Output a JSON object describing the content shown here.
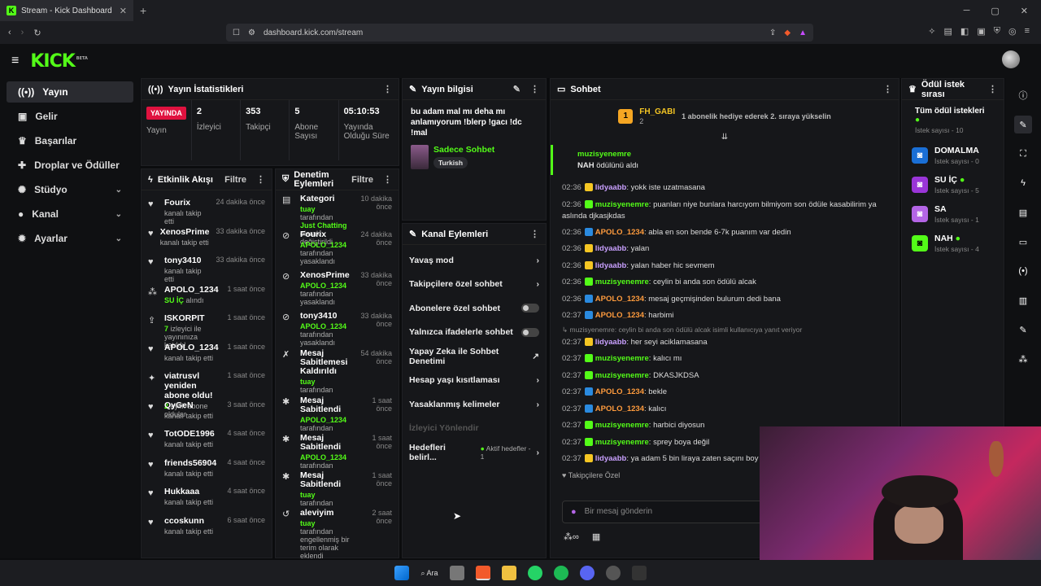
{
  "browser": {
    "tab_title": "Stream - Kick Dashboard",
    "url": "dashboard.kick.com/stream"
  },
  "brand": {
    "logo": "KICK",
    "beta": "BETA",
    "accent": "#53fc18"
  },
  "sidebar": {
    "items": [
      {
        "label": "Yayın",
        "icon": "broadcast-icon"
      },
      {
        "label": "Gelir",
        "icon": "wallet-icon"
      },
      {
        "label": "Başarılar",
        "icon": "trophy-icon"
      },
      {
        "label": "Droplar ve Ödüller",
        "icon": "gift-icon"
      },
      {
        "label": "Stüdyo",
        "icon": "gear-icon"
      },
      {
        "label": "Kanal",
        "icon": "person-icon"
      },
      {
        "label": "Ayarlar",
        "icon": "settings-icon"
      }
    ]
  },
  "stats": {
    "title": "Yayın İstatistikleri",
    "live_badge": "YAYINDA",
    "live_label": "Yayın",
    "viewers": "2",
    "viewers_label": "İzleyici",
    "followers": "353",
    "followers_label": "Takipçi",
    "subs": "5",
    "subs_label": "Abone Sayısı",
    "duration": "05:10:53",
    "duration_label": "Yayında Olduğu Süre"
  },
  "stream_info": {
    "title": "Yayın bilgisi",
    "stream_title": "bu adam mal mı deha mı anlamıyorum !blerp !gacı !dc !mal",
    "category": "Sadece Sohbet",
    "language": "Turkish"
  },
  "activity": {
    "title": "Etkinlik Akışı",
    "filter": "Filtre",
    "items": [
      {
        "name": "Fourix",
        "sub": "kanalı takip etti",
        "time": "24 dakika önce"
      },
      {
        "name": "XenosPrime",
        "sub": "kanalı takip etti",
        "time": "33 dakika önce"
      },
      {
        "name": "tony3410",
        "sub": "kanalı takip etti",
        "time": "33 dakika önce"
      },
      {
        "name": "APOLO_1234",
        "sub_hl": "SU İÇ",
        "sub": "alındı",
        "time": "1 saat önce"
      },
      {
        "name": "ISKORPIT",
        "sub_hl": "7",
        "sub": "izleyici ile yayınınıza katıldı!",
        "time": "1 saat önce"
      },
      {
        "name": "APOLO_1234",
        "sub": "kanalı takip etti",
        "time": "1 saat önce"
      },
      {
        "name": "viatrusvl yeniden abone oldu!",
        "sub_hl": "2",
        "sub": "aylık abone oldular",
        "time": "1 saat önce"
      },
      {
        "name": "QyGeN",
        "sub": "kanalı takip etti",
        "time": "3 saat önce"
      },
      {
        "name": "TotODE1996",
        "sub": "kanalı takip etti",
        "time": "4 saat önce"
      },
      {
        "name": "friends56904",
        "sub": "kanalı takip etti",
        "time": "4 saat önce"
      },
      {
        "name": "Hukkaaa",
        "sub": "kanalı takip etti",
        "time": "4 saat önce"
      },
      {
        "name": "ccoskunn",
        "sub": "kanalı takip etti",
        "time": "6 saat önce"
      }
    ]
  },
  "moderation": {
    "title": "Denetim Eylemleri",
    "filter": "Filtre",
    "items": [
      {
        "name": "Kategori",
        "hl": "tuay",
        "sub": "tarafından",
        "hl2": "Just Chatting",
        "sub2": "olarak değiştirildi",
        "time": "10 dakika önce"
      },
      {
        "name": "Fourix",
        "hl": "APOLO_1234",
        "sub": "tarafından yasaklandı",
        "time": "24 dakika önce"
      },
      {
        "name": "XenosPrime",
        "hl": "APOLO_1234",
        "sub": "tarafından yasaklandı",
        "time": "33 dakika önce"
      },
      {
        "name": "tony3410",
        "hl": "APOLO_1234",
        "sub": "tarafından yasaklandı",
        "time": "33 dakika önce"
      },
      {
        "name": "Mesaj Sabitlemesi Kaldırıldı",
        "hl": "tuay",
        "sub": "tarafından",
        "time": "54 dakika önce"
      },
      {
        "name": "Mesaj Sabitlendi",
        "hl": "APOLO_1234",
        "sub": "tarafından",
        "time": "1 saat önce"
      },
      {
        "name": "Mesaj Sabitlendi",
        "hl": "APOLO_1234",
        "sub": "tarafından",
        "time": "1 saat önce"
      },
      {
        "name": "Mesaj Sabitlendi",
        "hl": "tuay",
        "sub": "tarafından",
        "time": "1 saat önce"
      },
      {
        "name": "aleviyim",
        "hl": "tuay",
        "sub": "tarafından engellenmiş bir terim olarak eklendi",
        "time": "2 saat önce"
      }
    ]
  },
  "channel_actions": {
    "title": "Kanal Eylemleri",
    "items": [
      {
        "label": "Yavaş mod"
      },
      {
        "label": "Takipçilere özel sohbet"
      },
      {
        "label": "Abonelere özel sohbet"
      },
      {
        "label": "Yalnızca ifadelerle sohbet"
      },
      {
        "label": "Yapay Zeka ile Sohbet Denetimi"
      },
      {
        "label": "Hesap yaşı kısıtlaması"
      },
      {
        "label": "Yasaklanmış kelimeler"
      },
      {
        "label": "İzleyici Yönlendir"
      },
      {
        "label": "Hedefleri belirl...",
        "extra": "Aktif hedefler - 1"
      }
    ]
  },
  "chat": {
    "title": "Sohbet",
    "gift_user": "FH_GABI",
    "gift_count": "2",
    "gift_text": "1 abonelik hediye ederek 2. sıraya yükselin",
    "pinned_user": "muzisyenemre",
    "pinned_hl": "NAH",
    "pinned_text": "ödülünü aldı",
    "reply_note": "muzisyenemre: ceylin bi anda son ödülü alcak isimli kullanıcıya yanıt veriyor",
    "messages": [
      {
        "t": "02:36",
        "n": "lidyaabb",
        "c": "#c9a0ff",
        "m": "yokk iste uzatmasana"
      },
      {
        "t": "02:36",
        "n": "muzisyenemre",
        "c": "#53fc18",
        "m": "puanları niye bunlara harcıyom bilmiyom son ödüle kasabilirim ya aslında djkasjkdas"
      },
      {
        "t": "02:36",
        "n": "APOLO_1234",
        "c": "#ff9b3d",
        "m": "abla en son bende 6-7k puanım var dedin"
      },
      {
        "t": "02:36",
        "n": "lidyaabb",
        "c": "#c9a0ff",
        "m": "yalan"
      },
      {
        "t": "02:36",
        "n": "lidyaabb",
        "c": "#c9a0ff",
        "m": "yalan haber hic sevmem"
      },
      {
        "t": "02:36",
        "n": "muzisyenemre",
        "c": "#53fc18",
        "m": "ceylin bi anda son ödülü alcak"
      },
      {
        "t": "02:36",
        "n": "APOLO_1234",
        "c": "#ff9b3d",
        "m": "mesaj geçmişinden bulurum dedi bana"
      },
      {
        "t": "02:37",
        "n": "APOLO_1234",
        "c": "#ff9b3d",
        "m": "harbimi"
      },
      {
        "t": "02:37",
        "n": "lidyaabb",
        "c": "#c9a0ff",
        "m": "her seyi aciklamasana"
      },
      {
        "t": "02:37",
        "n": "muzisyenemre",
        "c": "#53fc18",
        "m": "kalıcı mı"
      },
      {
        "t": "02:37",
        "n": "muzisyenemre",
        "c": "#53fc18",
        "m": "DKASJKDSA"
      },
      {
        "t": "02:37",
        "n": "APOLO_1234",
        "c": "#ff9b3d",
        "m": "bekle"
      },
      {
        "t": "02:37",
        "n": "APOLO_1234",
        "c": "#ff9b3d",
        "m": "kalıcı"
      },
      {
        "t": "02:37",
        "n": "muzisyenemre",
        "c": "#53fc18",
        "m": "harbici diyosun"
      },
      {
        "t": "02:37",
        "n": "muzisyenemre",
        "c": "#53fc18",
        "m": "sprey boya değil"
      },
      {
        "t": "02:37",
        "n": "lidyaabb",
        "c": "#c9a0ff",
        "m": "ya adam 5 bin liraya zaten saçını boy"
      }
    ],
    "followers_only": "Takipçilere Özel",
    "input_placeholder": "Bir mesaj gönderin"
  },
  "rewards": {
    "title": "Ödül istek sırası",
    "all_label": "Tüm ödül istekleri",
    "all_count": "İstek sayısı - 10",
    "items": [
      {
        "name": "DOMALMA",
        "count": "İstek sayısı - 0",
        "color": "#1a6fd6"
      },
      {
        "name": "SU İÇ",
        "count": "İstek sayısı - 5",
        "color": "#9a35d8",
        "active": true
      },
      {
        "name": "SA",
        "count": "İstek sayısı - 1",
        "color": "#b465e6"
      },
      {
        "name": "NAH",
        "count": "İstek sayısı - 4",
        "color": "#53fc18",
        "active": true
      }
    ]
  },
  "taskbar": {
    "search": "Ara"
  }
}
